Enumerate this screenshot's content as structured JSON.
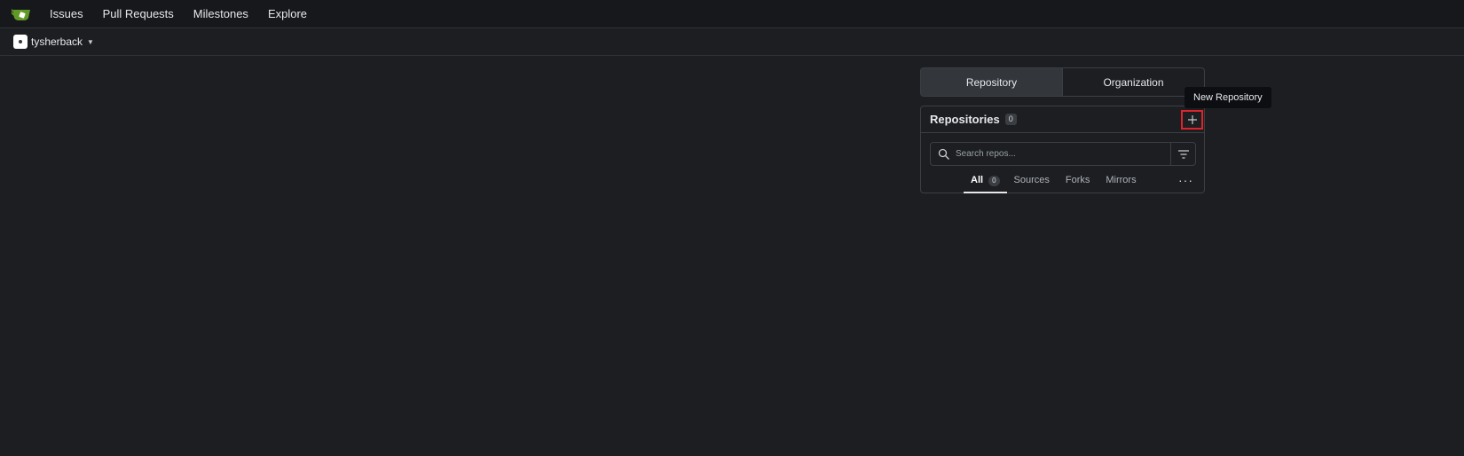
{
  "navbar": {
    "logo_icon": "gitea-logo-icon",
    "items": [
      {
        "label": "Issues"
      },
      {
        "label": "Pull Requests"
      },
      {
        "label": "Milestones"
      },
      {
        "label": "Explore"
      }
    ]
  },
  "context": {
    "user": "tysherback",
    "avatar_icon": "avatar-icon",
    "caret_icon": "caret-down-icon"
  },
  "switcher": {
    "repository": "Repository",
    "organization": "Organization",
    "active": "Repository"
  },
  "repos": {
    "title": "Repositories",
    "count": "0",
    "add_icon": "plus-icon",
    "tooltip": "New Repository",
    "search_placeholder": "Search repos...",
    "filter_icon": "filter-icon",
    "tabs": [
      {
        "label": "All",
        "count": "0",
        "active": true
      },
      {
        "label": "Sources"
      },
      {
        "label": "Forks"
      },
      {
        "label": "Mirrors"
      }
    ],
    "more_icon": "kebab-horizontal-icon"
  },
  "colors": {
    "background": "#1c1e21",
    "navbar": "#17181b",
    "highlight_border": "#e0242b",
    "logo_green": "#609926"
  }
}
